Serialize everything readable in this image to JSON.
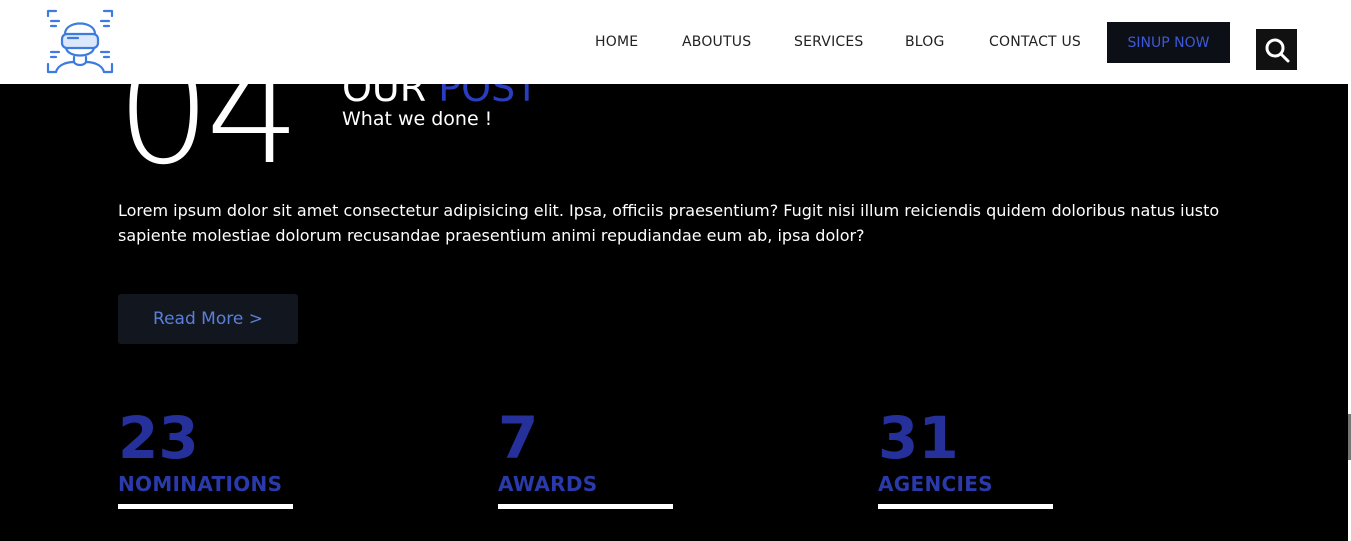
{
  "nav": {
    "logo_icon": "vr-headset-person-icon",
    "links": [
      "HOME",
      "ABOUTUS",
      "SERVICES",
      "BLOG",
      "CONTACT US"
    ],
    "signup_label": "SINUP NOW",
    "search_icon": "search-icon"
  },
  "hero": {
    "number": "04",
    "title_main": "OUR ",
    "title_accent": "POST",
    "subtitle": "What we done !",
    "paragraph": "Lorem ipsum dolor sit amet consectetur adipisicing elit. Ipsa, officiis praesentium? Fugit nisi illum reiciendis quidem doloribus natus iusto sapiente molestiae dolorum recusandae praesentium animi repudiandae eum ab, ipsa dolor?",
    "read_more_label": "Read More >"
  },
  "stats": [
    {
      "value": "23",
      "label": "NOMINATIONS"
    },
    {
      "value": "7",
      "label": "AWARDS"
    },
    {
      "value": "31",
      "label": "AGENCIES"
    }
  ],
  "colors": {
    "accent": "#2b3dbf",
    "stat_color": "#25309a",
    "button_text": "#5b7fd9",
    "background": "#000000"
  }
}
